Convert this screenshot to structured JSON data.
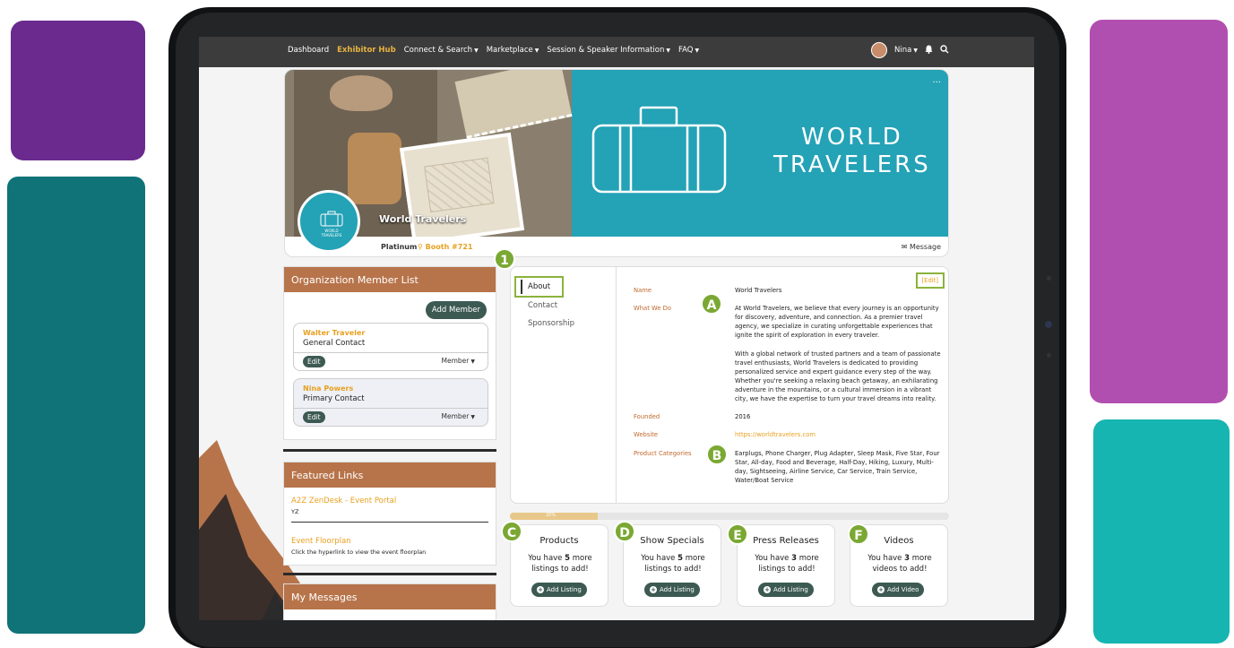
{
  "nav": {
    "items": [
      {
        "label": "Dashboard",
        "active": false,
        "dropdown": false
      },
      {
        "label": "Exhibitor Hub",
        "active": true,
        "dropdown": false
      },
      {
        "label": "Connect & Search",
        "active": false,
        "dropdown": true
      },
      {
        "label": "Marketplace",
        "active": false,
        "dropdown": true
      },
      {
        "label": "Session & Speaker Information",
        "active": false,
        "dropdown": true
      },
      {
        "label": "FAQ",
        "active": false,
        "dropdown": true
      }
    ],
    "user": "Nina",
    "icons": [
      "bell-icon",
      "search-icon"
    ]
  },
  "banner": {
    "brand_line1": "WORLD",
    "brand_line2": "TRAVELERS",
    "logo_text": "WORLD TRAVELERS",
    "company_name": "World Travelers",
    "tier": "Platinum",
    "booth": "Booth #721",
    "message_label": "Message",
    "more": "..."
  },
  "members_panel": {
    "title": "Organization Member List",
    "add_label": "Add Member",
    "members": [
      {
        "name": "Walter Traveler",
        "role": "General Contact",
        "edit": "Edit",
        "type": "Member"
      },
      {
        "name": "Nina Powers",
        "role": "Primary Contact",
        "edit": "Edit",
        "type": "Member"
      }
    ]
  },
  "links_panel": {
    "title": "Featured Links",
    "links": [
      {
        "title": "A2Z ZenDesk - Event Portal",
        "sub": "YZ"
      },
      {
        "title": "Event Floorplan",
        "sub": "Click the hyperlink to view the event floorplan"
      }
    ]
  },
  "messages_panel": {
    "title": "My Messages"
  },
  "about": {
    "tabs": [
      "About",
      "Contact",
      "Sponsorship"
    ],
    "edit_label": "[Edit]",
    "fields": {
      "name_label": "Name",
      "name_value": "World Travelers",
      "what_label": "What We Do",
      "what_p1": "At World Travelers, we believe that every journey is an opportunity for discovery, adventure, and connection. As a premier travel agency, we specialize in curating unforgettable experiences that ignite the spirit of exploration in every traveler.",
      "what_p2": "With a global network of trusted partners and a team of passionate travel enthusiasts, World Travelers is dedicated to providing personalized service and expert guidance every step of the way. Whether you're seeking a relaxing beach getaway, an exhilarating adventure in the mountains, or a cultural immersion in a vibrant city, we have the expertise to turn your travel dreams into reality.",
      "founded_label": "Founded",
      "founded_value": "2016",
      "website_label": "Website",
      "website_value": "https://worldtravelers.com",
      "categories_label": "Product Categories",
      "categories_value": "Earplugs, Phone Charger, Plug Adapter, Sleep Mask, Five Star, Four Star, All-day, Food and Beverage, Half-Day, Hiking, Luxury, Multi-day, Sightseeing, Airline Service, Car Service, Train Service, Water/Boat Service"
    }
  },
  "progress": {
    "label": "20%",
    "fraction": 0.2
  },
  "badges": {
    "one": "1",
    "a": "A",
    "b": "B",
    "c": "C",
    "d": "D",
    "e": "E",
    "f": "F"
  },
  "cards": [
    {
      "title": "Products",
      "pre": "You have ",
      "count": "5",
      "post": " more listings to add!",
      "button": "Add Listing"
    },
    {
      "title": "Show Specials",
      "pre": "You have ",
      "count": "5",
      "post": " more listings to add!",
      "button": "Add Listing"
    },
    {
      "title": "Press Releases",
      "pre": "You have ",
      "count": "3",
      "post": " more listings to add!",
      "button": "Add Listing"
    },
    {
      "title": "Videos",
      "pre": "You have ",
      "count": "3",
      "post": " more videos to add!",
      "button": "Add Video"
    }
  ],
  "colors": {
    "accent_orange": "#e8a020",
    "panel_brown": "#b7744a",
    "button_green": "#3d5a52",
    "badge_green": "#7aa832",
    "banner_teal": "#24a2b6"
  }
}
